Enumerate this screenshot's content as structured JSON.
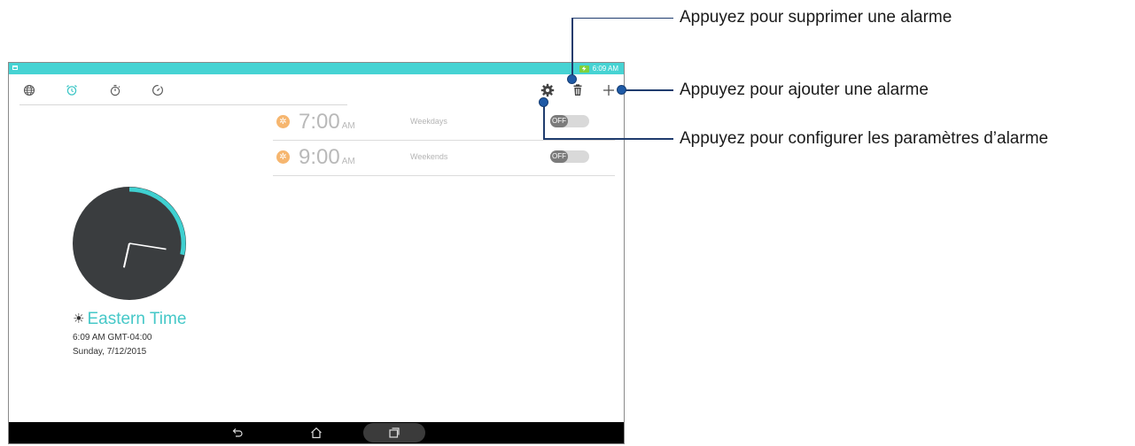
{
  "status_bar": {
    "time": "6:09 AM",
    "icons": [
      "notification-icon",
      "battery-charging-icon"
    ]
  },
  "tabs": [
    {
      "name": "world-clock",
      "icon": "globe-icon",
      "active": false
    },
    {
      "name": "alarm",
      "icon": "alarm-clock-icon",
      "active": true
    },
    {
      "name": "stopwatch",
      "icon": "stopwatch-icon",
      "active": false
    },
    {
      "name": "timer",
      "icon": "timer-icon",
      "active": false
    }
  ],
  "actions": [
    {
      "name": "settings",
      "icon": "gear-icon"
    },
    {
      "name": "delete",
      "icon": "trash-icon"
    },
    {
      "name": "add",
      "icon": "plus-icon"
    }
  ],
  "alarms": [
    {
      "time": "7:00",
      "ampm": "AM",
      "days": "Weekdays",
      "toggle": "OFF"
    },
    {
      "time": "9:00",
      "ampm": "AM",
      "days": "Weekends",
      "toggle": "OFF"
    }
  ],
  "clock": {
    "timezone": "Eastern Time",
    "time_line": "6:09 AM   GMT-04:00",
    "date_line": "Sunday, 7/12/2015",
    "hour": 6,
    "minute": 9
  },
  "callouts": [
    {
      "text": "Appuyez pour supprimer une alarme"
    },
    {
      "text": "Appuyez pour ajouter une alarme"
    },
    {
      "text": "Appuyez pour configurer les paramètres d’alarme"
    }
  ],
  "colors": {
    "accent": "#46d3d3",
    "clock_face": "#3a3d3f",
    "callout": "#1f5aa6"
  }
}
